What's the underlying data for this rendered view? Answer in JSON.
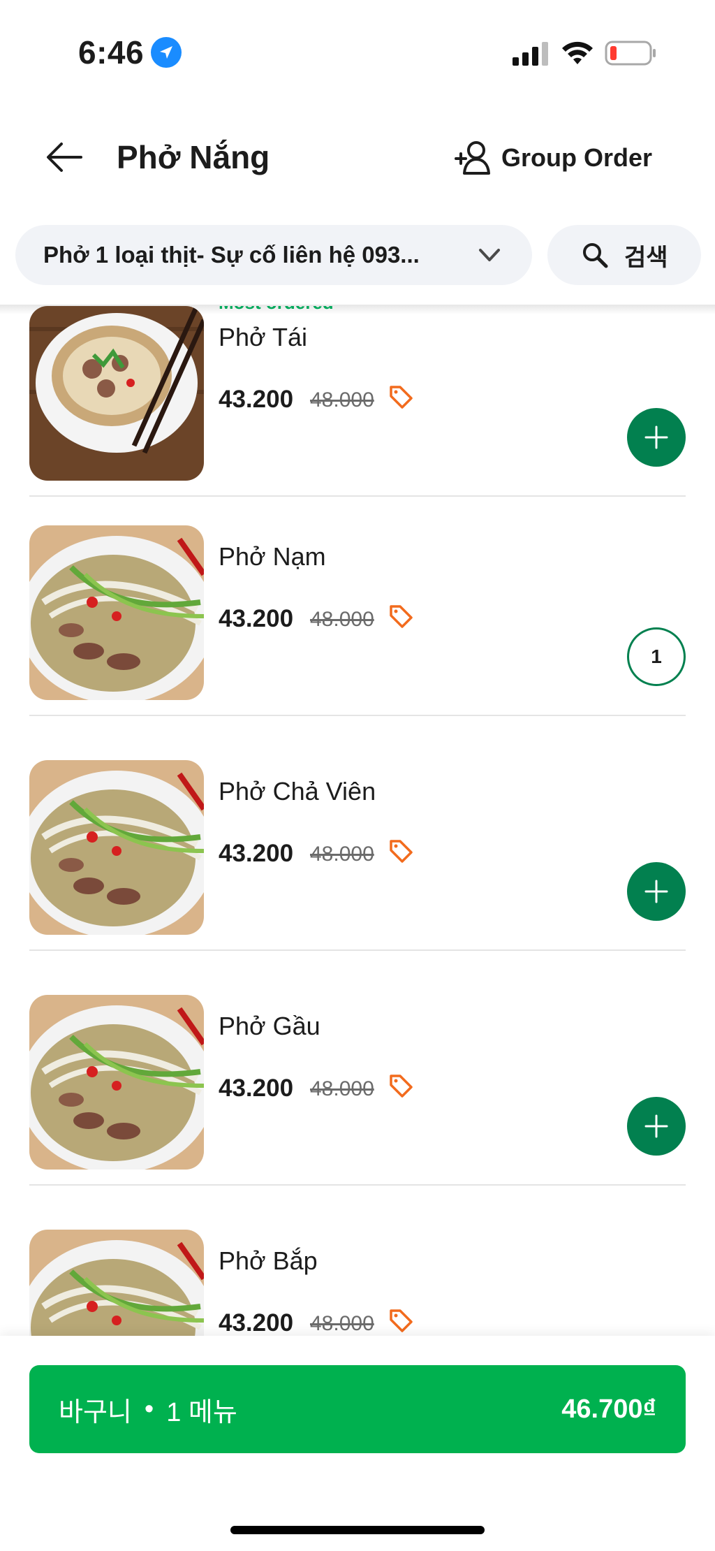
{
  "status_bar": {
    "time": "6:46",
    "icons": [
      "location-arrow-icon",
      "cellular-signal-icon",
      "wifi-icon",
      "battery-low-icon"
    ]
  },
  "header": {
    "store_name": "Phở Nắng",
    "group_order_label": "Group Order"
  },
  "filters": {
    "category_selected": "Phở 1 loại thịt- Sự cố liên hệ 093...",
    "search_label": "검색"
  },
  "menu": {
    "most_ordered_label": "Most ordered",
    "items": [
      {
        "name": "Phở Tái",
        "price": "43.200",
        "original_price": "48.000",
        "quantity": null
      },
      {
        "name": "Phở Nạm",
        "price": "43.200",
        "original_price": "48.000",
        "quantity": "1"
      },
      {
        "name": "Phở Chả Viên",
        "price": "43.200",
        "original_price": "48.000",
        "quantity": null
      },
      {
        "name": "Phở Gầu",
        "price": "43.200",
        "original_price": "48.000",
        "quantity": null
      },
      {
        "name": "Phở Bắp",
        "price": "43.200",
        "original_price": "48.000",
        "quantity": null
      }
    ]
  },
  "cart": {
    "label": "바구니",
    "separator": "•",
    "count": "1 메뉴",
    "total": "46.700₫"
  },
  "colors": {
    "brand_green": "#00b14f",
    "add_button_green": "#02804f",
    "discount_tag_orange": "#f26b1d",
    "chip_background": "#f1f3f7"
  }
}
